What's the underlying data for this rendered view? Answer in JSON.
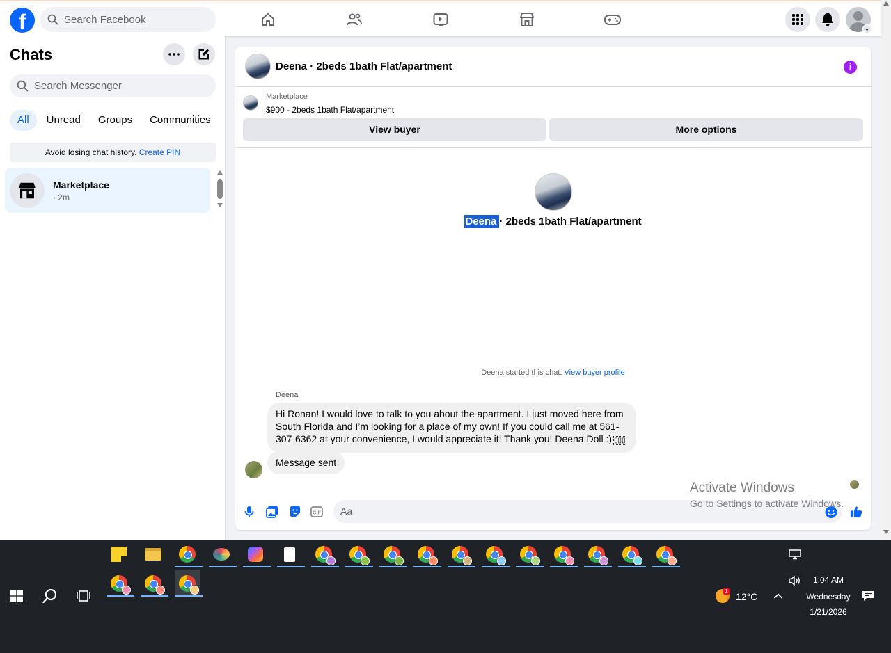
{
  "topbar": {
    "logo": "f",
    "search_placeholder": "Search Facebook",
    "nav_icons": [
      "home-icon",
      "friends-icon",
      "video-icon",
      "marketplace-icon",
      "gaming-icon"
    ],
    "right_icons": [
      "menu-grid-icon",
      "notifications-icon",
      "account-avatar"
    ]
  },
  "sidebar": {
    "title": "Chats",
    "search_placeholder": "Search Messenger",
    "filters": [
      "All",
      "Unread",
      "Groups",
      "Communities"
    ],
    "active_filter": "All",
    "pin_notice": "Avoid losing chat history.",
    "pin_link": "Create PIN",
    "chats": [
      {
        "name": "Marketplace",
        "time": "· 2m"
      }
    ]
  },
  "chat": {
    "header_title": "Deena · 2beds 1bath Flat/apartment",
    "marketplace_label": "Marketplace",
    "listing": "$900 - 2beds 1bath Flat/apartment",
    "view_buyer": "View buyer",
    "more_options": "More options",
    "center_name": "Deena",
    "center_rest": "· 2beds 1bath Flat/apartment",
    "started_text": "Deena started this chat.",
    "started_link": "View buyer profile",
    "sender": "Deena",
    "message": "Hi Ronan! I would love to talk to you about the apartment. I just moved here from South Florida and I’m looking for a place of my own! If you could call me at 561-307-6362 at your convenience, I would appreciate it! Thank you! Deena Doll :)",
    "message_sent": "Message sent",
    "composer_placeholder": "Aa"
  },
  "watermark": {
    "line1": "Activate Windows",
    "line2": "Go to Settings to activate Windows."
  },
  "taskbar": {
    "temperature": "12°C",
    "time": "1:04 AM",
    "day": "Wednesday",
    "date": "1/21/2026",
    "weather_badge": "1"
  },
  "colors": {
    "facebook_blue": "#0866ff",
    "info_purple": "#a020f0",
    "selection": "#1a5fd6"
  }
}
